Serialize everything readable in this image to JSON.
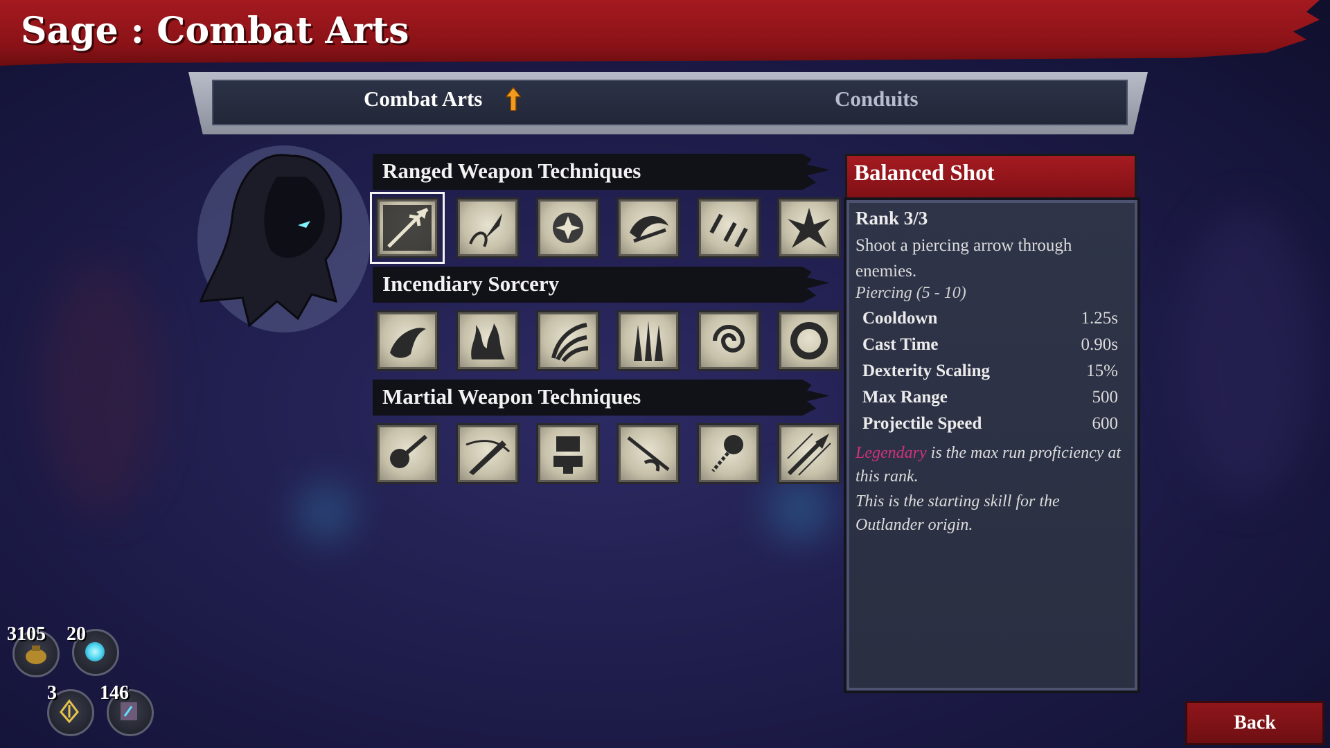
{
  "header": {
    "title": "Sage : Combat Arts"
  },
  "tabs": [
    {
      "label": "Combat Arts",
      "active": true,
      "upgrade_indicator": "arrow-up-icon"
    },
    {
      "label": "Conduits",
      "active": false
    }
  ],
  "sections": [
    {
      "title": "Ranged Weapon Techniques",
      "skills": [
        "arrow-shot-icon",
        "dagger-throw-icon",
        "star-burst-icon",
        "crescent-slash-icon",
        "triple-knives-icon",
        "spike-burst-icon"
      ],
      "selected_index": 0
    },
    {
      "title": "Incendiary Sorcery",
      "skills": [
        "fireball-icon",
        "flame-wall-icon",
        "fire-claw-icon",
        "fire-spikes-icon",
        "fire-vortex-icon",
        "fire-ring-icon"
      ]
    },
    {
      "title": "Martial Weapon Techniques",
      "skills": [
        "mace-spin-icon",
        "sword-slash-icon",
        "anvil-smash-icon",
        "flail-sweep-icon",
        "ball-chain-icon",
        "spear-thrust-icon"
      ]
    }
  ],
  "detail": {
    "title": "Balanced Shot",
    "rank": "Rank 3/3",
    "description": "Shoot a piercing arrow through enemies.",
    "tag": "Piercing  (5 - 10)",
    "stats": [
      {
        "label": "Cooldown",
        "value": "1.25s"
      },
      {
        "label": "Cast Time",
        "value": "0.90s"
      },
      {
        "label": "Dexterity Scaling",
        "value": "15%"
      },
      {
        "label": "Max Range",
        "value": "500"
      },
      {
        "label": "Projectile Speed",
        "value": "600"
      }
    ],
    "proficiency_word": "Legendary",
    "proficiency_rest": " is the max run proficiency at this rank.",
    "origin_note": "This is the starting skill for the Outlander origin."
  },
  "currencies": [
    {
      "value": "3105",
      "icon": "gold-pouch-icon"
    },
    {
      "value": "20",
      "icon": "blue-orb-icon"
    },
    {
      "value": "3",
      "icon": "rune-icon"
    },
    {
      "value": "146",
      "icon": "map-scroll-icon"
    }
  ],
  "back_label": "Back",
  "colors": {
    "banner_red": "#8a1217",
    "panel": "#2f3448",
    "legendary": "#d0327a"
  }
}
